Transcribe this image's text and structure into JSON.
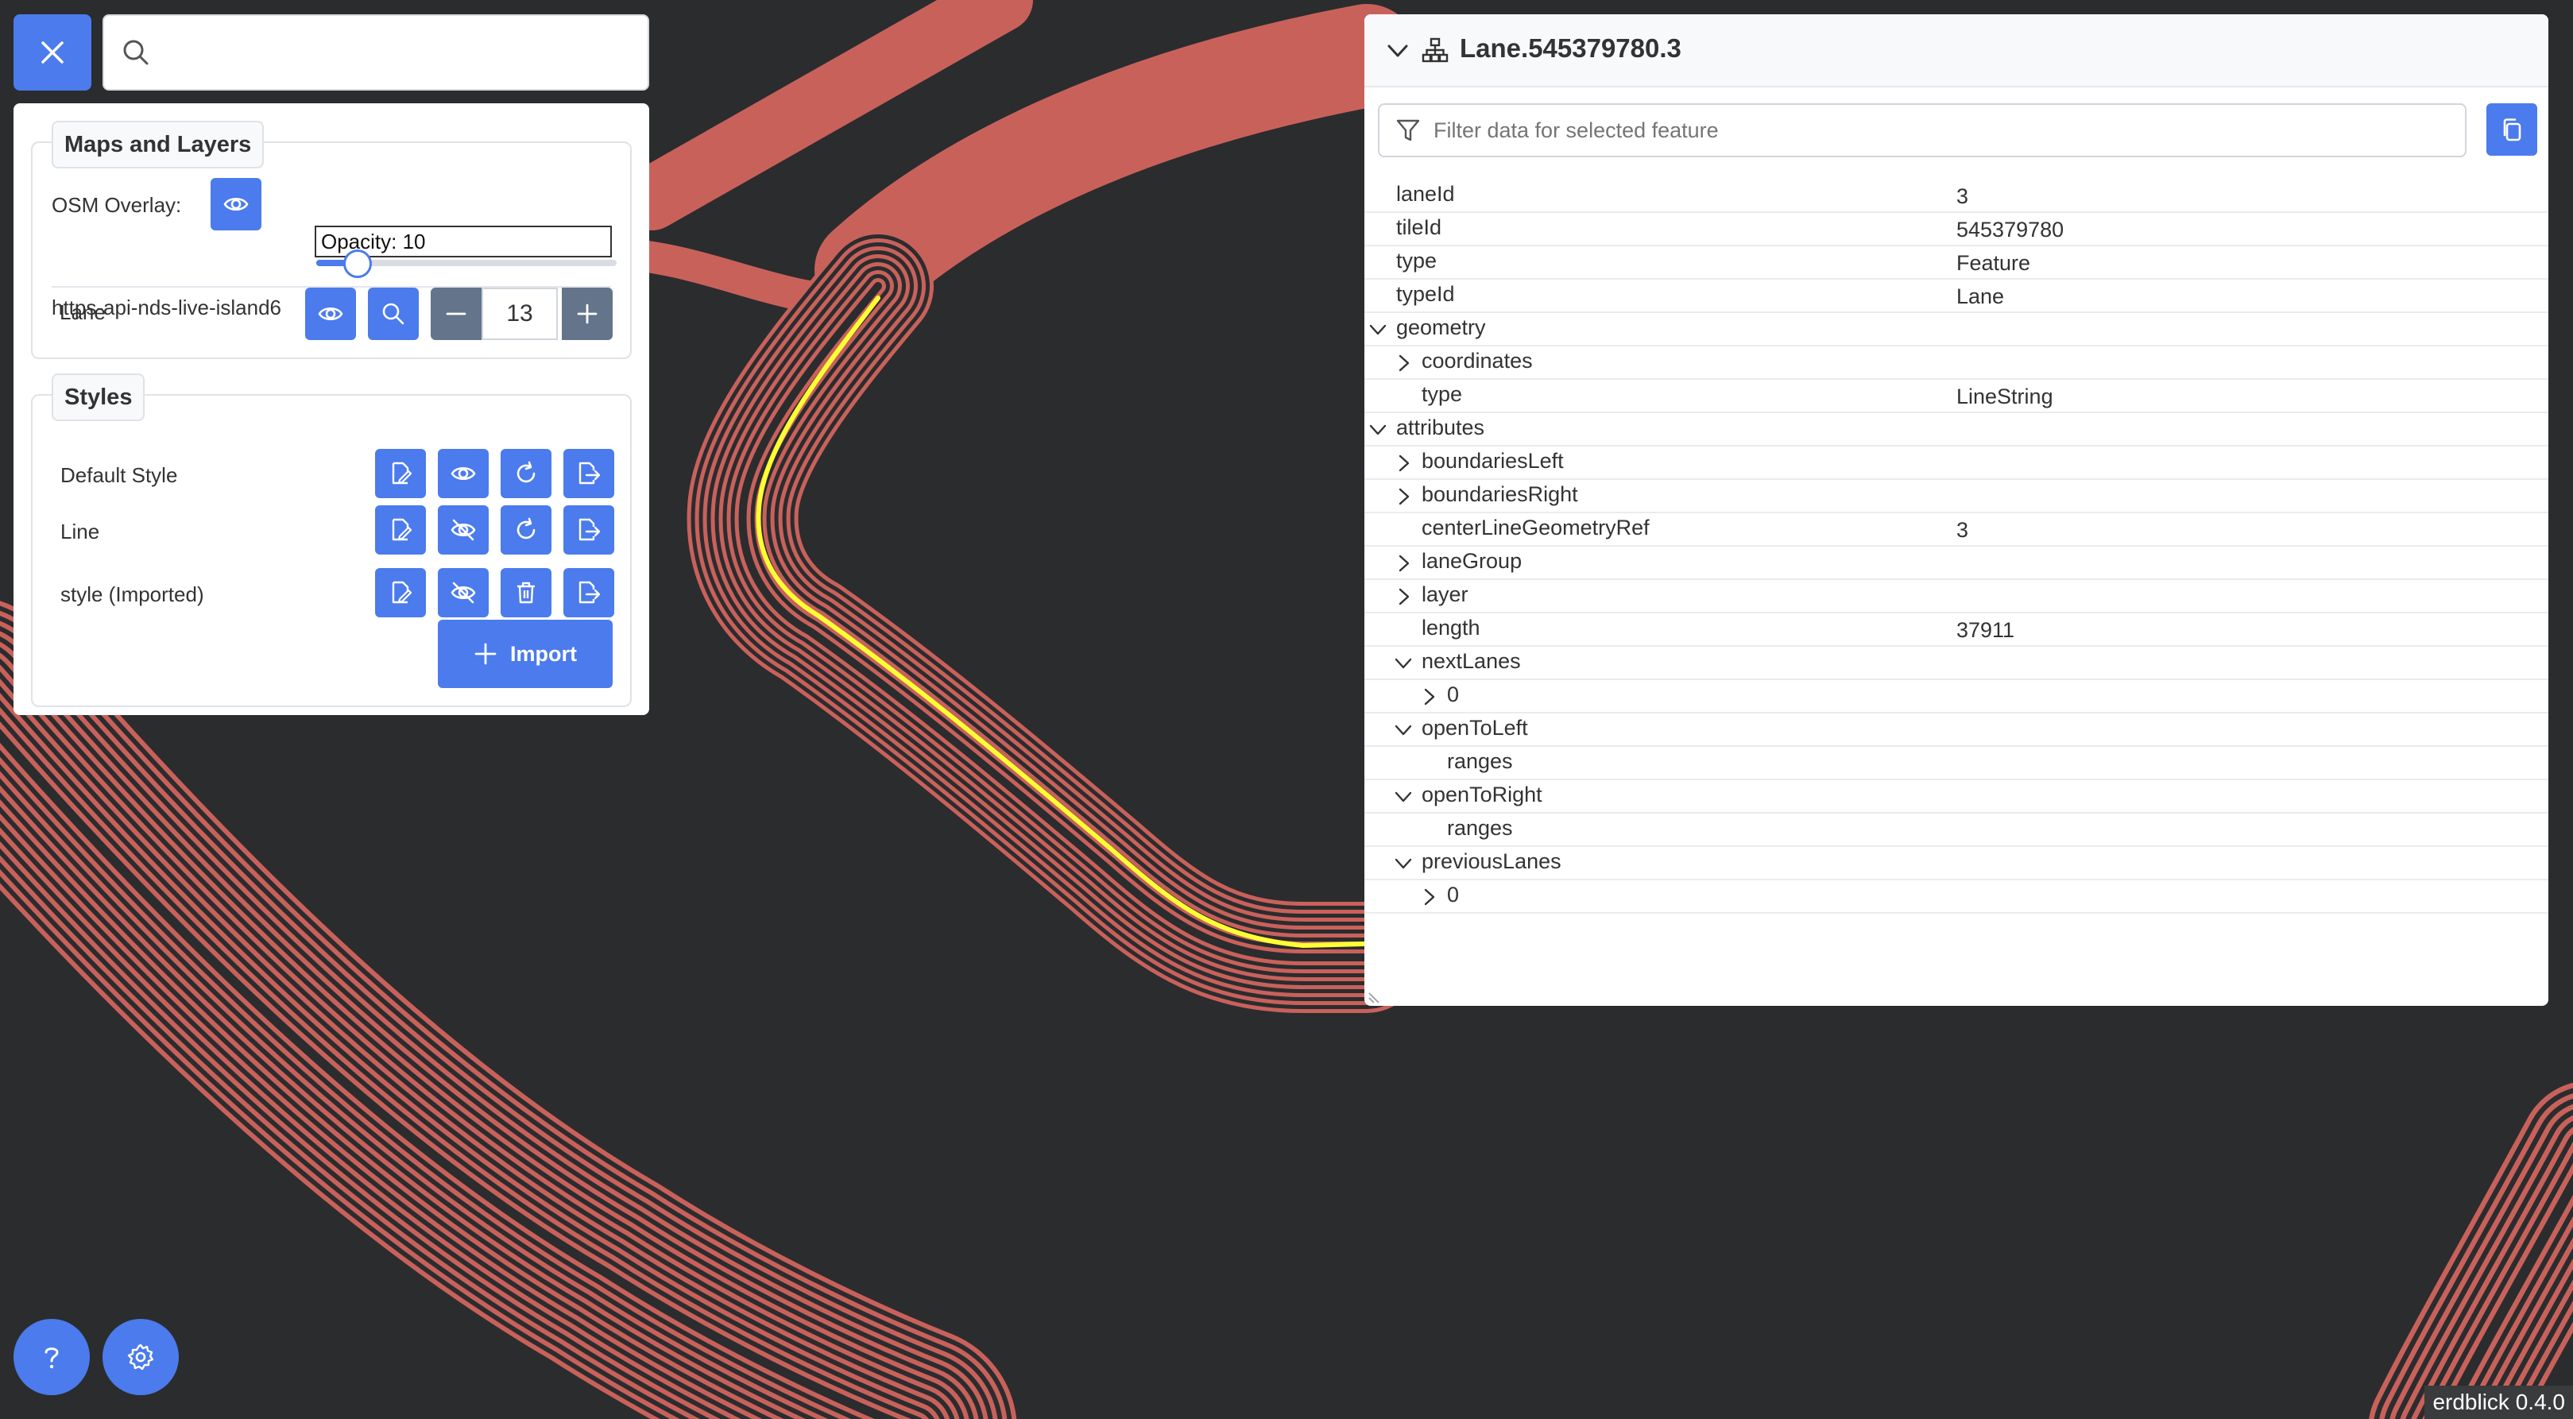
{
  "search": {
    "placeholder": "",
    "value": ""
  },
  "maps_layers": {
    "title": "Maps and Layers",
    "osm_overlay_label": "OSM Overlay:",
    "opacity_text": "Opacity: 10",
    "opacity_value": 10,
    "map_source": "https-api-nds-live-island6",
    "layer_name": "Lane",
    "zoom_level": "13"
  },
  "styles": {
    "title": "Styles",
    "items": [
      {
        "name": "Default Style",
        "visible": true,
        "third_action": "reload"
      },
      {
        "name": "Line",
        "visible": false,
        "third_action": "reload"
      },
      {
        "name": "style (Imported)",
        "visible": false,
        "third_action": "delete"
      }
    ],
    "import_label": "Import"
  },
  "inspector": {
    "title": "Lane.545379780.3",
    "filter_placeholder": "Filter data for selected feature",
    "rows": [
      {
        "key": "laneId",
        "value": "3",
        "depth": 0,
        "toggle": "none"
      },
      {
        "key": "tileId",
        "value": "545379780",
        "depth": 0,
        "toggle": "none"
      },
      {
        "key": "type",
        "value": "Feature",
        "depth": 0,
        "toggle": "none"
      },
      {
        "key": "typeId",
        "value": "Lane",
        "depth": 0,
        "toggle": "none"
      },
      {
        "key": "geometry",
        "value": "",
        "depth": 0,
        "toggle": "open"
      },
      {
        "key": "coordinates",
        "value": "",
        "depth": 1,
        "toggle": "closed"
      },
      {
        "key": "type",
        "value": "LineString",
        "depth": 1,
        "toggle": "none"
      },
      {
        "key": "attributes",
        "value": "",
        "depth": 0,
        "toggle": "open"
      },
      {
        "key": "boundariesLeft",
        "value": "",
        "depth": 1,
        "toggle": "closed"
      },
      {
        "key": "boundariesRight",
        "value": "",
        "depth": 1,
        "toggle": "closed"
      },
      {
        "key": "centerLineGeometryRef",
        "value": "3",
        "depth": 1,
        "toggle": "none"
      },
      {
        "key": "laneGroup",
        "value": "",
        "depth": 1,
        "toggle": "closed"
      },
      {
        "key": "layer",
        "value": "",
        "depth": 1,
        "toggle": "closed"
      },
      {
        "key": "length",
        "value": "37911",
        "depth": 1,
        "toggle": "none"
      },
      {
        "key": "nextLanes",
        "value": "",
        "depth": 1,
        "toggle": "open"
      },
      {
        "key": "0",
        "value": "",
        "depth": 2,
        "toggle": "closed"
      },
      {
        "key": "openToLeft",
        "value": "",
        "depth": 1,
        "toggle": "open"
      },
      {
        "key": "ranges",
        "value": "",
        "depth": 2,
        "toggle": "none"
      },
      {
        "key": "openToRight",
        "value": "",
        "depth": 1,
        "toggle": "open"
      },
      {
        "key": "ranges",
        "value": "",
        "depth": 2,
        "toggle": "none"
      },
      {
        "key": "previousLanes",
        "value": "",
        "depth": 1,
        "toggle": "open"
      },
      {
        "key": "0",
        "value": "",
        "depth": 2,
        "toggle": "closed"
      }
    ]
  },
  "footer": {
    "version": "erdblick 0.4.0"
  },
  "colors": {
    "background": "#2b2c2e",
    "lane": "#c9615b",
    "selected_lane": "#ffff33",
    "accent": "#4b7bec",
    "secondary": "#64748b"
  }
}
